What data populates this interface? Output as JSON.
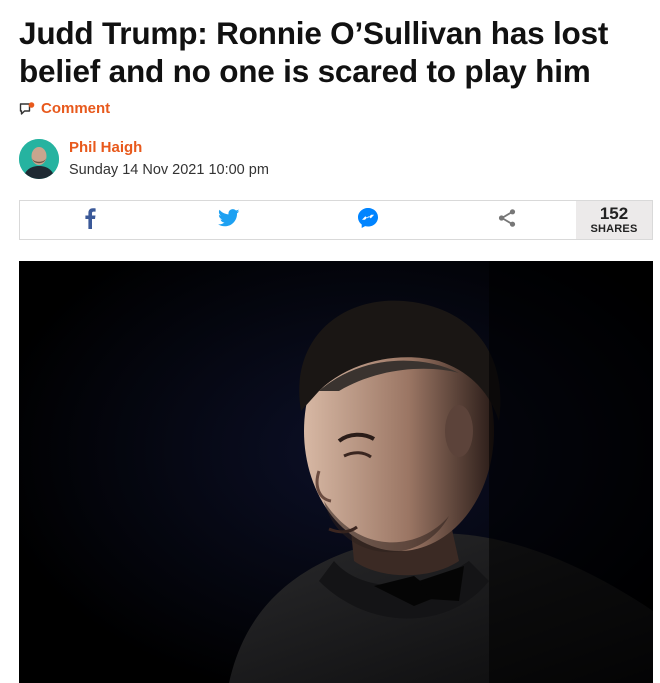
{
  "article": {
    "headline": "Judd Trump: Ronnie O’Sullivan has lost belief and no one is scared to play him",
    "comment_label": "Comment",
    "author": "Phil Haigh",
    "date": "Sunday 14 Nov 2021 10:00 pm"
  },
  "share": {
    "count": "152",
    "count_label": "SHARES",
    "buttons": [
      "facebook-icon",
      "twitter-icon",
      "messenger-icon",
      "share-icon"
    ]
  },
  "colors": {
    "accent": "#e8591c",
    "facebook": "#3b5998",
    "twitter": "#1da1f2",
    "messenger": "#0084ff",
    "share_icon": "#777777"
  }
}
